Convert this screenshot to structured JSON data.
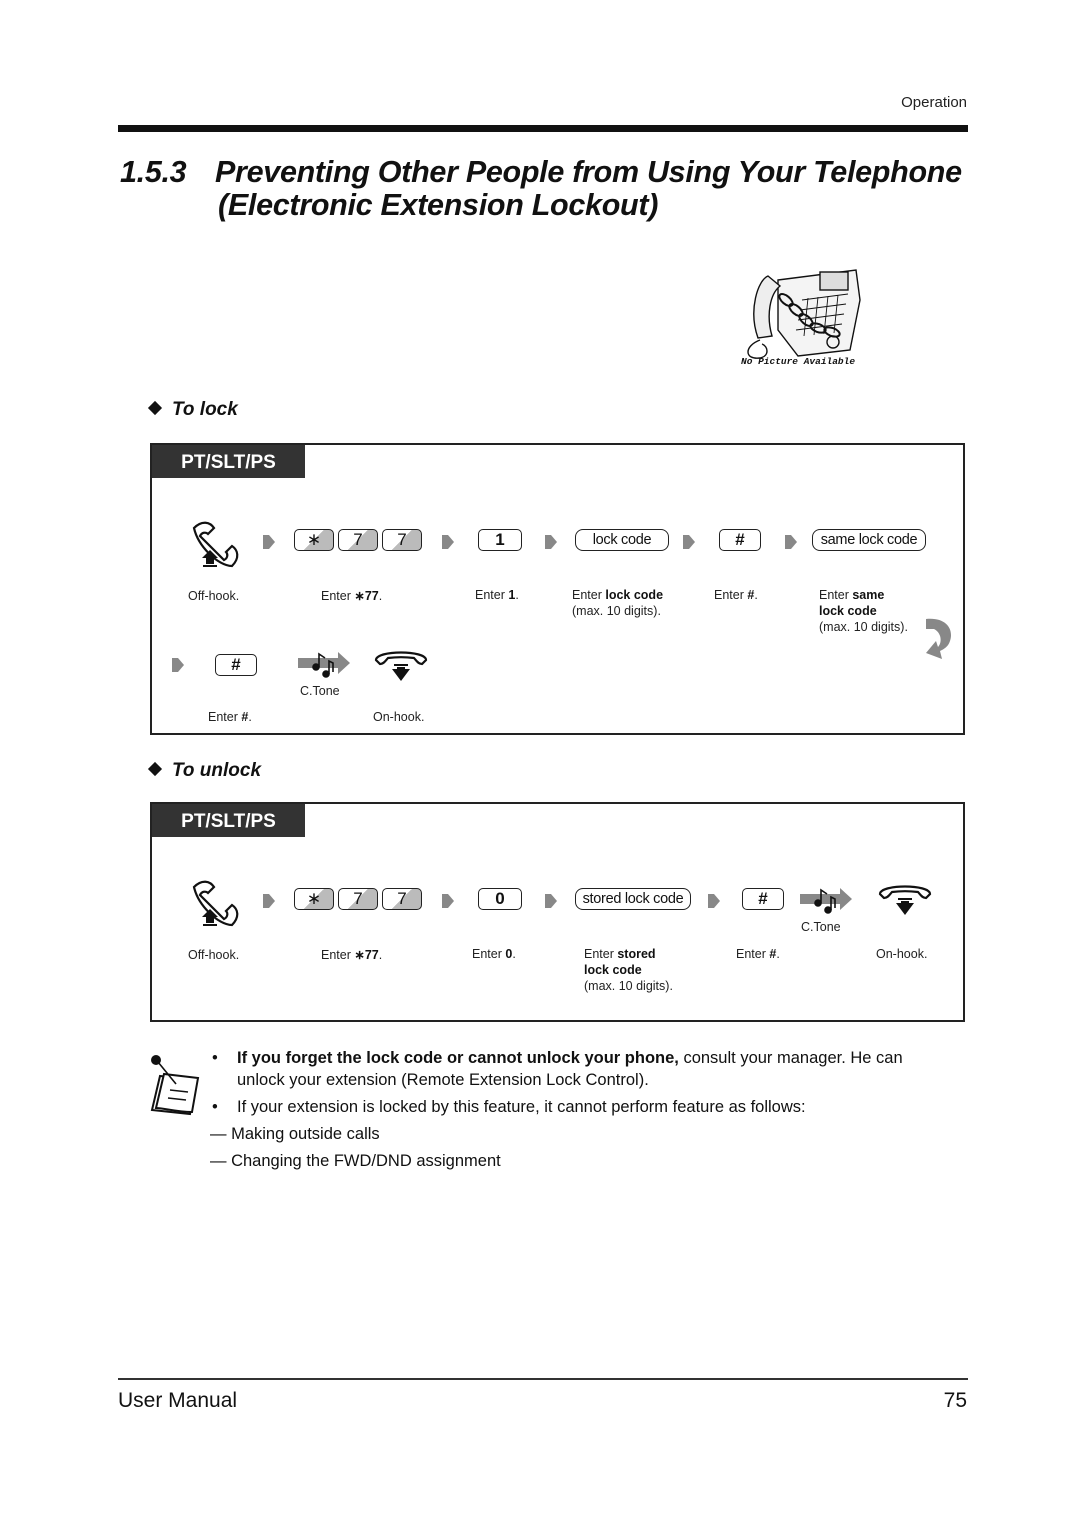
{
  "header": {
    "section_label": "Operation"
  },
  "title": {
    "number": "1.5.3",
    "line1": "Preventing Other People from Using Your Telephone",
    "line2": "(Electronic Extension Lockout)"
  },
  "figure": {
    "caption": "No Picture Available",
    "icon": "chained-phone-icon"
  },
  "lock": {
    "heading": "To lock",
    "tag": "PT/SLT/PS",
    "keys": {
      "star": "∗",
      "seven_a": "7",
      "seven_b": "7",
      "one": "1",
      "lock_code": "lock code",
      "hash1": "#",
      "same_lock_code": "same lock code",
      "hash2": "#"
    },
    "captions": {
      "offhook": "Off-hook.",
      "star77_pre": "Enter ",
      "star77_bold": "∗77",
      "star77_post": ".",
      "one_pre": "Enter ",
      "one_bold": "1",
      "one_post": ".",
      "lockcode_pre": "Enter ",
      "lockcode_bold": "lock code",
      "lockcode_line2": "(max. 10 digits).",
      "hash_pre": "Enter ",
      "hash_bold": "#",
      "hash_post": ".",
      "same_pre": "Enter ",
      "same_bold1": "same",
      "same_bold2": "lock code",
      "same_line3": "(max. 10 digits).",
      "hash2_pre": "Enter ",
      "hash2_bold": "#",
      "hash2_post": ".",
      "ctone": "C.Tone",
      "onhook": "On-hook."
    }
  },
  "unlock": {
    "heading": "To unlock",
    "tag": "PT/SLT/PS",
    "keys": {
      "star": "∗",
      "seven_a": "7",
      "seven_b": "7",
      "zero": "0",
      "stored_lock_code": "stored lock code",
      "hash": "#"
    },
    "captions": {
      "offhook": "Off-hook.",
      "star77_pre": "Enter ",
      "star77_bold": "∗77",
      "star77_post": ".",
      "zero_pre": "Enter ",
      "zero_bold": "0",
      "zero_post": ".",
      "stored_pre": "Enter ",
      "stored_bold1": "stored",
      "stored_bold2": "lock code",
      "stored_line3": "(max. 10 digits).",
      "hash_pre": "Enter ",
      "hash_bold": "#",
      "hash_post": ".",
      "ctone": "C.Tone",
      "onhook": "On-hook."
    }
  },
  "notes": {
    "bullet1_bold": "If you forget the lock code or cannot unlock your phone,",
    "bullet1_rest": " consult your manager. He can",
    "bullet1_line2": "unlock your extension (Remote Extension Lock Control).",
    "bullet2": "If your extension is locked by this feature, it cannot perform feature as follows:",
    "dash_items": [
      "Making outside calls",
      "Changing the FWD/DND assignment"
    ]
  },
  "footer": {
    "left": "User Manual",
    "page_number": "75"
  }
}
